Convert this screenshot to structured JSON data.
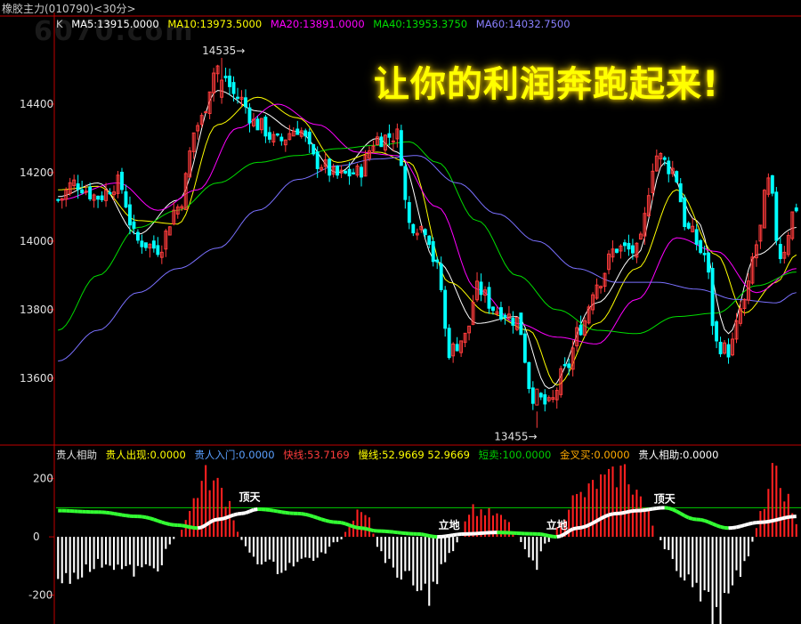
{
  "window": {
    "title": "橡胶主力(010790)<30分>",
    "watermark": "6070.com"
  },
  "main_legend": {
    "k_label": "K",
    "ma5": "MA5:13915.0000",
    "ma10": "MA10:13973.5000",
    "ma20": "MA20:13891.0000",
    "ma40": "MA40:13953.3750",
    "ma60": "MA60:14032.7500"
  },
  "slogan": "让你的利润奔跑起来!",
  "annotations": {
    "high": "14535",
    "low": "13455"
  },
  "sub_legend": {
    "name": "贵人相助",
    "appear": "贵人出现:0.0000",
    "enter": "贵人入门:0.0000",
    "fast": "快线:53.7169",
    "slow": "慢线:52.9669 52.9669",
    "short_sell": "短卖:100.0000",
    "golden_cross": "金叉买:0.0000",
    "help": "贵人相助:0.0000"
  },
  "sub_markers": {
    "top1": "顶天",
    "ground1": "立地",
    "ground2": "立地",
    "top2": "顶天"
  },
  "colors": {
    "up": "#ff3c3c",
    "down": "#00ffff",
    "ma5": "#ffffff",
    "ma10": "#ffff00",
    "ma20": "#ff00ff",
    "ma40": "#00dd00",
    "ma60": "#7a70ff",
    "axis": "#c00000",
    "hist_up": "#ff2020",
    "hist_down": "#ffffff",
    "level_line": "#00cc00"
  },
  "chart_data": [
    {
      "type": "candlestick",
      "y_ticks": [
        14400,
        14200,
        14000,
        13800,
        13600
      ],
      "ylim": [
        13410,
        14600
      ],
      "high_label": 14535,
      "low_label": 13455,
      "close_anchors": [
        [
          0,
          14120
        ],
        [
          4,
          14170
        ],
        [
          10,
          14130
        ],
        [
          15,
          14170
        ],
        [
          20,
          14000
        ],
        [
          25,
          13980
        ],
        [
          30,
          14100
        ],
        [
          35,
          14340
        ],
        [
          40,
          14510
        ],
        [
          45,
          14420
        ],
        [
          50,
          14340
        ],
        [
          55,
          14290
        ],
        [
          60,
          14330
        ],
        [
          65,
          14230
        ],
        [
          70,
          14190
        ],
        [
          75,
          14200
        ],
        [
          80,
          14300
        ],
        [
          85,
          14310
        ],
        [
          88,
          14050
        ],
        [
          92,
          14040
        ],
        [
          95,
          13920
        ],
        [
          98,
          13680
        ],
        [
          102,
          13720
        ],
        [
          105,
          13860
        ],
        [
          110,
          13800
        ],
        [
          115,
          13770
        ],
        [
          119,
          13550
        ],
        [
          123,
          13520
        ],
        [
          127,
          13620
        ],
        [
          131,
          13750
        ],
        [
          135,
          13880
        ],
        [
          140,
          13980
        ],
        [
          145,
          13970
        ],
        [
          150,
          14250
        ],
        [
          154,
          14210
        ],
        [
          158,
          14030
        ],
        [
          162,
          13960
        ],
        [
          165,
          13700
        ],
        [
          168,
          13680
        ],
        [
          172,
          13820
        ],
        [
          175,
          13990
        ],
        [
          178,
          14170
        ],
        [
          181,
          13960
        ],
        [
          185,
          14100
        ]
      ],
      "ma_anchors": {
        "MA5": [
          [
            0,
            14130
          ],
          [
            10,
            14170
          ],
          [
            20,
            14020
          ],
          [
            30,
            14120
          ],
          [
            40,
            14440
          ],
          [
            50,
            14380
          ],
          [
            60,
            14320
          ],
          [
            70,
            14200
          ],
          [
            80,
            14300
          ],
          [
            85,
            14260
          ],
          [
            95,
            13940
          ],
          [
            105,
            13760
          ],
          [
            115,
            13780
          ],
          [
            123,
            13570
          ],
          [
            135,
            13820
          ],
          [
            145,
            13960
          ],
          [
            152,
            14230
          ],
          [
            160,
            14060
          ],
          [
            168,
            13730
          ],
          [
            175,
            13960
          ],
          [
            185,
            14040
          ]
        ],
        "MA10": [
          [
            0,
            14150
          ],
          [
            10,
            14160
          ],
          [
            20,
            14060
          ],
          [
            30,
            14050
          ],
          [
            40,
            14340
          ],
          [
            50,
            14420
          ],
          [
            60,
            14360
          ],
          [
            70,
            14230
          ],
          [
            80,
            14260
          ],
          [
            88,
            14230
          ],
          [
            98,
            13880
          ],
          [
            108,
            13790
          ],
          [
            118,
            13740
          ],
          [
            125,
            13580
          ],
          [
            135,
            13760
          ],
          [
            145,
            13920
          ],
          [
            155,
            14150
          ],
          [
            165,
            13960
          ],
          [
            172,
            13790
          ],
          [
            180,
            13880
          ],
          [
            185,
            13960
          ]
        ],
        "MA20": [
          [
            0,
            14120
          ],
          [
            15,
            14170
          ],
          [
            25,
            14090
          ],
          [
            35,
            14150
          ],
          [
            45,
            14330
          ],
          [
            55,
            14400
          ],
          [
            65,
            14340
          ],
          [
            75,
            14260
          ],
          [
            85,
            14250
          ],
          [
            95,
            14100
          ],
          [
            105,
            13860
          ],
          [
            115,
            13760
          ],
          [
            125,
            13720
          ],
          [
            135,
            13700
          ],
          [
            145,
            13830
          ],
          [
            155,
            14010
          ],
          [
            165,
            13970
          ],
          [
            175,
            13850
          ],
          [
            185,
            13920
          ]
        ],
        "MA40": [
          [
            0,
            13740
          ],
          [
            10,
            13900
          ],
          [
            20,
            14040
          ],
          [
            30,
            14090
          ],
          [
            40,
            14170
          ],
          [
            50,
            14230
          ],
          [
            60,
            14250
          ],
          [
            70,
            14270
          ],
          [
            80,
            14280
          ],
          [
            88,
            14290
          ],
          [
            95,
            14230
          ],
          [
            105,
            14060
          ],
          [
            115,
            13900
          ],
          [
            125,
            13800
          ],
          [
            135,
            13740
          ],
          [
            145,
            13730
          ],
          [
            155,
            13780
          ],
          [
            165,
            13790
          ],
          [
            175,
            13870
          ],
          [
            185,
            13910
          ]
        ],
        "MA60": [
          [
            0,
            13650
          ],
          [
            10,
            13740
          ],
          [
            20,
            13850
          ],
          [
            30,
            13920
          ],
          [
            40,
            13980
          ],
          [
            50,
            14090
          ],
          [
            60,
            14180
          ],
          [
            70,
            14220
          ],
          [
            80,
            14240
          ],
          [
            90,
            14250
          ],
          [
            100,
            14170
          ],
          [
            110,
            14080
          ],
          [
            120,
            14000
          ],
          [
            130,
            13920
          ],
          [
            140,
            13880
          ],
          [
            150,
            13880
          ],
          [
            160,
            13860
          ],
          [
            170,
            13830
          ],
          [
            180,
            13820
          ],
          [
            185,
            13850
          ]
        ]
      }
    },
    {
      "type": "bar",
      "name": "贵人相助",
      "y_ticks": [
        200,
        0,
        -200
      ],
      "ylim": [
        -290,
        260
      ],
      "level": 100,
      "bar_anchors": [
        [
          0,
          -150
        ],
        [
          6,
          -120
        ],
        [
          12,
          -90
        ],
        [
          18,
          -120
        ],
        [
          24,
          -110
        ],
        [
          30,
          0
        ],
        [
          32,
          60
        ],
        [
          35,
          160
        ],
        [
          37,
          210
        ],
        [
          40,
          180
        ],
        [
          43,
          120
        ],
        [
          45,
          20
        ],
        [
          47,
          -40
        ],
        [
          50,
          -80
        ],
        [
          55,
          -110
        ],
        [
          60,
          -90
        ],
        [
          65,
          -70
        ],
        [
          70,
          -20
        ],
        [
          73,
          30
        ],
        [
          75,
          80
        ],
        [
          78,
          60
        ],
        [
          80,
          -40
        ],
        [
          84,
          -110
        ],
        [
          87,
          -150
        ],
        [
          90,
          -170
        ],
        [
          93,
          -200
        ],
        [
          96,
          -120
        ],
        [
          99,
          -50
        ],
        [
          101,
          0
        ],
        [
          103,
          100
        ],
        [
          106,
          90
        ],
        [
          109,
          80
        ],
        [
          112,
          60
        ],
        [
          115,
          0
        ],
        [
          118,
          -60
        ],
        [
          120,
          -100
        ],
        [
          122,
          -30
        ],
        [
          124,
          0
        ],
        [
          126,
          60
        ],
        [
          129,
          130
        ],
        [
          132,
          150
        ],
        [
          135,
          190
        ],
        [
          138,
          200
        ],
        [
          142,
          230
        ],
        [
          145,
          160
        ],
        [
          148,
          80
        ],
        [
          150,
          0
        ],
        [
          153,
          -60
        ],
        [
          156,
          -120
        ],
        [
          159,
          -180
        ],
        [
          162,
          -230
        ],
        [
          165,
          -280
        ],
        [
          168,
          -220
        ],
        [
          171,
          -130
        ],
        [
          173,
          -60
        ],
        [
          175,
          30
        ],
        [
          177,
          120
        ],
        [
          179,
          220
        ],
        [
          182,
          160
        ],
        [
          185,
          40
        ]
      ],
      "line_anchors": [
        [
          0,
          90
        ],
        [
          10,
          85
        ],
        [
          20,
          70
        ],
        [
          30,
          40
        ],
        [
          35,
          30
        ],
        [
          40,
          60
        ],
        [
          46,
          80
        ],
        [
          50,
          95
        ],
        [
          60,
          80
        ],
        [
          70,
          50
        ],
        [
          76,
          30
        ],
        [
          80,
          20
        ],
        [
          90,
          10
        ],
        [
          95,
          0
        ],
        [
          102,
          10
        ],
        [
          110,
          15
        ],
        [
          120,
          10
        ],
        [
          125,
          0
        ],
        [
          130,
          30
        ],
        [
          140,
          80
        ],
        [
          145,
          90
        ],
        [
          152,
          100
        ],
        [
          160,
          60
        ],
        [
          168,
          30
        ],
        [
          176,
          50
        ],
        [
          185,
          70
        ]
      ]
    }
  ]
}
